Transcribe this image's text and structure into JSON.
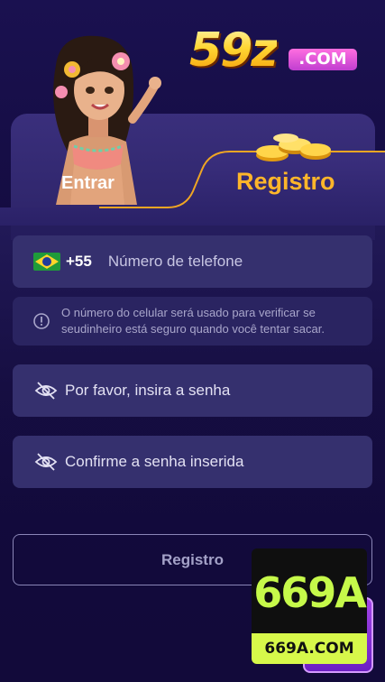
{
  "brand": {
    "number": "59z",
    "suffix": ".COM"
  },
  "tabs": {
    "login": "Entrar",
    "register": "Registro"
  },
  "form": {
    "phone": {
      "country_code": "+55",
      "placeholder": "Número de telefone",
      "flag": "brazil-flag"
    },
    "hint": "O número do celular será usado para verificar se seudinheiro está seguro quando você tentar sacar.",
    "password": {
      "placeholder": "Por favor, insira a senha"
    },
    "confirm_password": {
      "placeholder": "Confirme a senha inserida"
    },
    "submit_label": "Registro"
  },
  "watermark": {
    "top_text": "669A",
    "bottom_text": "669A.COM"
  },
  "colors": {
    "background": "#140d45",
    "field": "#35306e",
    "accent": "#ffb62a",
    "tab_border": "#f0a623"
  },
  "icons": {
    "info": "info-circle-icon",
    "password_visibility": "eye-off-icon"
  }
}
